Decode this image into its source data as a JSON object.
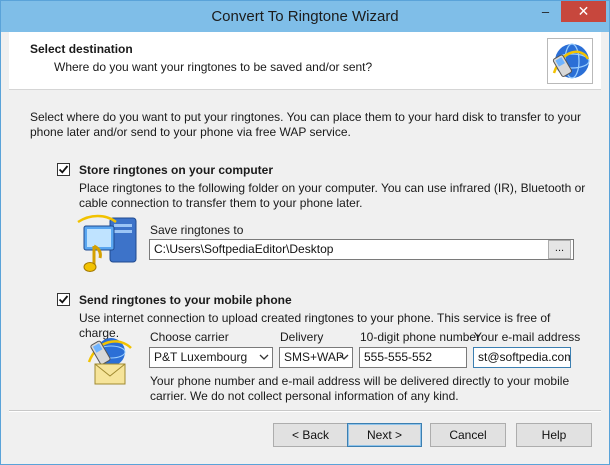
{
  "window": {
    "title": "Convert To Ringtone Wizard",
    "minimize_glyph": "–",
    "close_glyph": "✕"
  },
  "header": {
    "title": "Select destination",
    "subtitle": "Where do you want your ringtones to be saved and/or sent?",
    "logo_icon": "phone-globe-icon"
  },
  "intro": "Select where do you want to put your ringtones. You can place them to your hard disk to transfer to your phone later and/or send to your phone via free WAP service.",
  "store": {
    "checked": true,
    "label": "Store ringtones on your computer",
    "description": "Place ringtones to the following folder on your computer. You can use infrared (IR), Bluetooth or cable connection to transfer them to your phone later.",
    "folder_label": "Save ringtones to",
    "folder_value": "C:\\Users\\SoftpediaEditor\\Desktop",
    "browse_label": "...",
    "icon": "computer-music-icon"
  },
  "send": {
    "checked": true,
    "label": "Send ringtones to your mobile phone",
    "description": "Use internet connection to upload created ringtones to your phone. This service is free of charge.",
    "carrier_label": "Choose carrier",
    "carrier_value": "P&T Luxembourg",
    "delivery_label": "Delivery",
    "delivery_value": "SMS+WAP",
    "phone_label": "10-digit phone number",
    "phone_value": "555-555-552",
    "email_label": "Your e-mail address",
    "email_value": "st@softpedia.com",
    "note": "Your phone number and e-mail address will be delivered directly to your mobile carrier. We do not collect personal information of any kind.",
    "icon": "phone-envelope-icon"
  },
  "buttons": {
    "back": "< Back",
    "next": "Next >",
    "cancel": "Cancel",
    "help": "Help"
  }
}
